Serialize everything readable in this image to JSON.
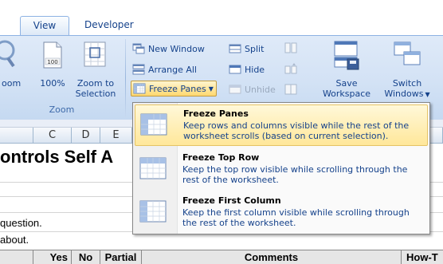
{
  "tabs": {
    "view": "View",
    "developer": "Developer"
  },
  "ribbon": {
    "zoom_group": {
      "label": "Zoom",
      "partial_label": "oom",
      "hundred_label": "100%",
      "hundred_icon_text": "100",
      "zoom_to_selection_line1": "Zoom to",
      "zoom_to_selection_line2": "Selection"
    },
    "window_group": {
      "new_window": "New Window",
      "arrange_all": "Arrange All",
      "freeze_panes": "Freeze Panes",
      "split": "Split",
      "hide": "Hide",
      "unhide": "Unhide",
      "save_workspace_line1": "Save",
      "save_workspace_line2": "Workspace",
      "switch_windows_line1": "Switch",
      "switch_windows_line2": "Windows"
    }
  },
  "sheet": {
    "columns": [
      "C",
      "D",
      "E"
    ],
    "title_fragment": "ontrols Self A",
    "row1_text": "question.",
    "row2_text": "about.",
    "header_cells": {
      "yes": "Yes",
      "no": "No",
      "partial": "Partial",
      "comments": "Comments",
      "howto": "How-T"
    }
  },
  "freeze_menu": {
    "items": [
      {
        "title": "Freeze Panes",
        "description": "Keep rows and columns visible while the rest of the worksheet scrolls (based on current selection)."
      },
      {
        "title": "Freeze Top Row",
        "description": "Keep the top row visible while scrolling through the rest of the worksheet."
      },
      {
        "title": "Freeze First Column",
        "description": "Keep the first column visible while scrolling through the rest of the worksheet."
      }
    ]
  },
  "colors": {
    "ribbon_text": "#15428b",
    "highlight_top": "#fff8d9",
    "highlight_bottom": "#ffe79a",
    "highlight_border": "#e5c365"
  }
}
